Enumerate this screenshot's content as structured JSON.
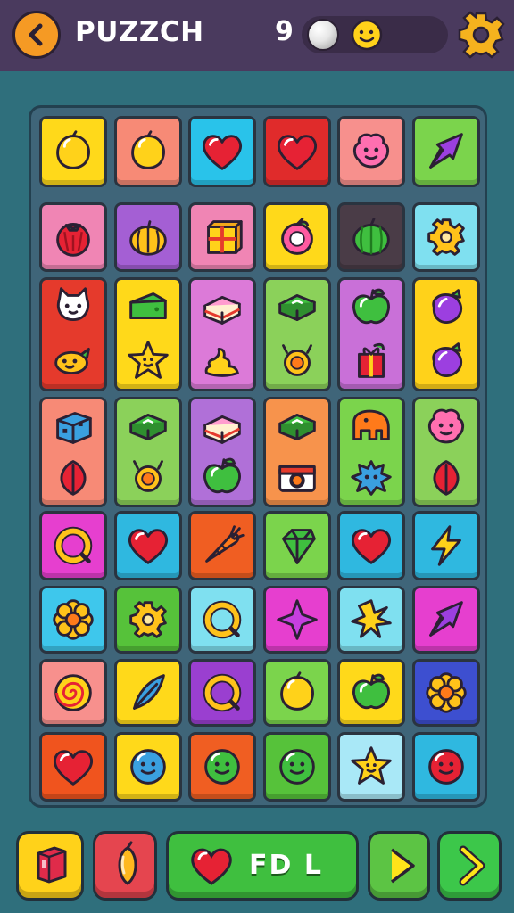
{
  "header": {
    "title": "PUZZCH",
    "count": "9"
  },
  "footer": {
    "main_button_label": "FD L"
  },
  "colors": {
    "yellow": "#ffd91a",
    "salmon": "#f78a76",
    "cyan": "#29c3ea",
    "red": "#e02b2b",
    "pink": "#f7908d",
    "green": "#7bd44c",
    "violet": "#a45fd4",
    "magenta": "#e65ad2",
    "orange": "#f26a22",
    "teal": "#4cc3e8",
    "dark": "#4a3c47",
    "lightblue": "#a9e8f7"
  },
  "tiles": [
    {
      "icon": "lemon-icon",
      "color": "#ffd91a"
    },
    {
      "icon": "lemon-icon",
      "color": "#f78a76"
    },
    {
      "icon": "heart-icon",
      "color": "#29c3ea"
    },
    {
      "icon": "heart-icon",
      "color": "#e02b2b"
    },
    {
      "icon": "blob-face-icon",
      "color": "#f7908d"
    },
    {
      "icon": "arrow-icon",
      "color": "#7bd44c"
    },
    {
      "icon": "tomato-icon",
      "color": "#f085b4"
    },
    {
      "icon": "pumpkin-icon",
      "color": "#a45fd4"
    },
    {
      "icon": "box-icon",
      "color": "#f085b4"
    },
    {
      "icon": "peach-icon",
      "color": "#ffd91a"
    },
    {
      "icon": "melon-icon",
      "color": "#4a3c47"
    },
    {
      "icon": "gear-icon",
      "color": "#7fe0f0"
    },
    {
      "icon": "cat-face-icon",
      "color": "#e53a2c",
      "tall": true,
      "icon2": "fish-icon"
    },
    {
      "icon": "cheese-icon",
      "color": "#ffd91a",
      "tall": true,
      "icon2": "star-icon"
    },
    {
      "icon": "cake-icon",
      "color": "#dc7ad8",
      "tall": true,
      "icon2": "swirl-icon"
    },
    {
      "icon": "book-icon",
      "color": "#8bd15a",
      "tall": true,
      "icon2": "bug-icon"
    },
    {
      "icon": "apple-icon",
      "color": "#c970d8",
      "tall": true,
      "icon2": "gift-icon"
    },
    {
      "icon": "eggplant-icon",
      "color": "#ffd21a",
      "tall": true,
      "icon2": "eggplant-icon"
    },
    {
      "icon": "cube-icon",
      "color": "#f78a76",
      "tall": true,
      "icon2": "leaf-icon"
    },
    {
      "icon": "book-icon",
      "color": "#8bd15a",
      "tall": true,
      "icon2": "bug-icon"
    },
    {
      "icon": "cake-icon",
      "color": "#b070d8",
      "tall": true,
      "icon2": "apple-icon"
    },
    {
      "icon": "book-icon",
      "color": "#f7934c",
      "tall": true,
      "icon2": "camera-icon"
    },
    {
      "icon": "elephant-icon",
      "color": "#7bd44c",
      "tall": true,
      "icon2": "splat-icon"
    },
    {
      "icon": "blob-face-icon",
      "color": "#8bd15a",
      "tall": true,
      "icon2": "leaf-icon"
    },
    {
      "icon": "ring-icon",
      "color": "#e63fcf"
    },
    {
      "icon": "heart-icon",
      "color": "#2fb8e0"
    },
    {
      "icon": "carrot-icon",
      "color": "#f05e22"
    },
    {
      "icon": "gem-icon",
      "color": "#7bd44c"
    },
    {
      "icon": "heart-icon",
      "color": "#2fb8e0"
    },
    {
      "icon": "bolt-icon",
      "color": "#2fb8e0"
    },
    {
      "icon": "flower-icon",
      "color": "#3ec7ec"
    },
    {
      "icon": "gear-icon",
      "color": "#56c23a"
    },
    {
      "icon": "ring-icon",
      "color": "#7fe0f0"
    },
    {
      "icon": "star4-icon",
      "color": "#e63fcf"
    },
    {
      "icon": "sparkle-icon",
      "color": "#7fe0f0"
    },
    {
      "icon": "arrow-icon",
      "color": "#e63fcf"
    },
    {
      "icon": "spiral-icon",
      "color": "#f7908d"
    },
    {
      "icon": "feather-icon",
      "color": "#ffd91a"
    },
    {
      "icon": "ring-icon",
      "color": "#9a3fd0"
    },
    {
      "icon": "lemon-icon",
      "color": "#7bd44c"
    },
    {
      "icon": "apple-icon",
      "color": "#ffd91a"
    },
    {
      "icon": "flower-icon",
      "color": "#3d4fd0"
    },
    {
      "icon": "heart-icon",
      "color": "#f0541e"
    },
    {
      "icon": "ball-face-icon",
      "color": "#ffd91a"
    },
    {
      "icon": "ball-face-icon",
      "color": "#f05e22"
    },
    {
      "icon": "ball-face-icon",
      "color": "#56c23a"
    },
    {
      "icon": "star-icon",
      "color": "#a9e8f7"
    },
    {
      "icon": "ball-face-icon",
      "color": "#2fb8e0"
    }
  ]
}
